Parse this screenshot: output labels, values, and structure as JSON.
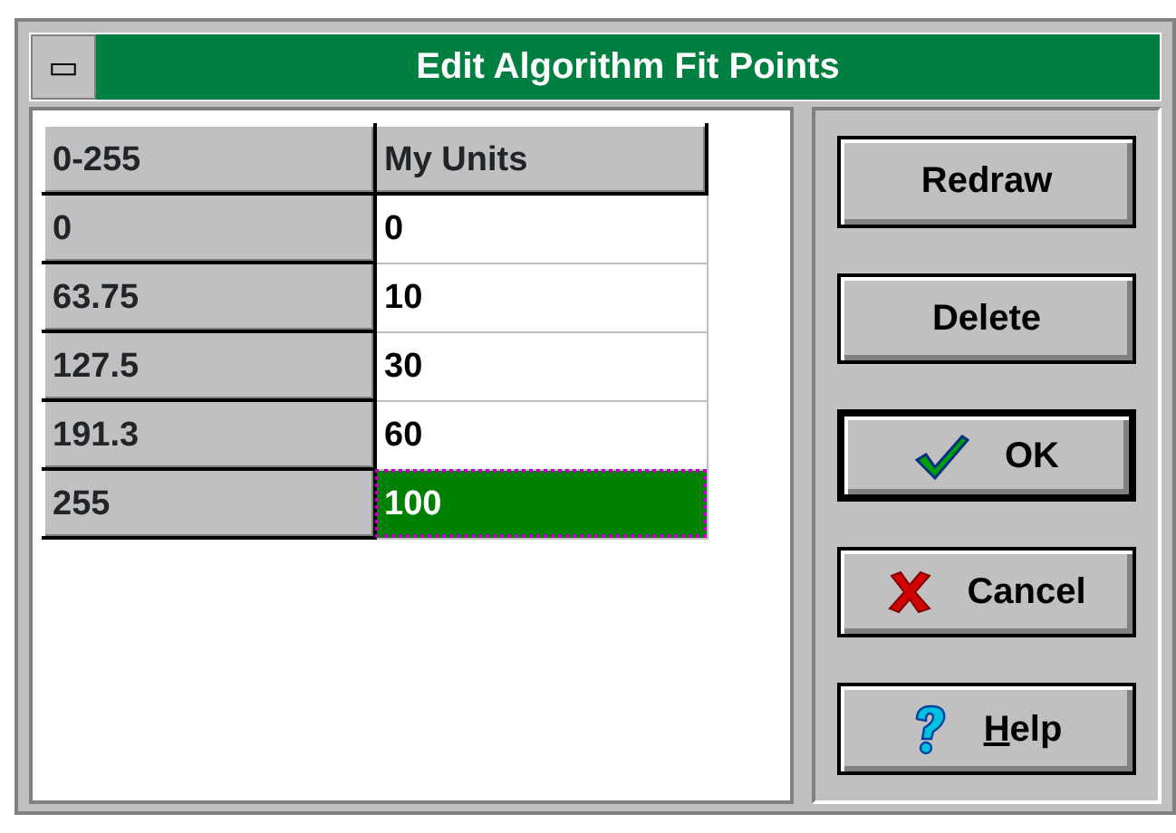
{
  "window": {
    "title": "Edit Algorithm Fit Points",
    "control_menu": "▭"
  },
  "table": {
    "columns": [
      "0-255",
      "My Units"
    ],
    "rows": [
      {
        "cells": [
          "0",
          "0"
        ],
        "selected": false
      },
      {
        "cells": [
          "63.75",
          "10"
        ],
        "selected": false
      },
      {
        "cells": [
          "127.5",
          "30"
        ],
        "selected": false
      },
      {
        "cells": [
          "191.3",
          "60"
        ],
        "selected": false
      },
      {
        "cells": [
          "255",
          "100"
        ],
        "selected": true
      }
    ]
  },
  "buttons": [
    {
      "label": "Redraw",
      "kind": "plain",
      "default": false,
      "underline_first": false
    },
    {
      "label": "Delete",
      "kind": "plain",
      "default": false,
      "underline_first": false
    },
    {
      "label": "OK",
      "kind": "ok",
      "default": true,
      "underline_first": false
    },
    {
      "label": "Cancel",
      "kind": "cancel",
      "default": false,
      "underline_first": false
    },
    {
      "label": "Help",
      "kind": "help",
      "default": false,
      "underline_first": true
    }
  ]
}
